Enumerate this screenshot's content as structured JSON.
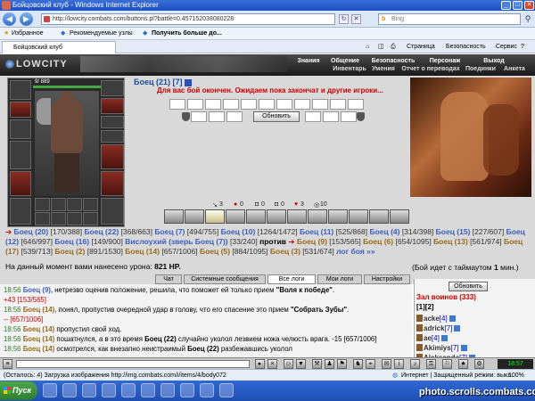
{
  "window": {
    "title": "Бойцовский клуб - Windows Internet Explorer"
  },
  "browser": {
    "url": "http://lowcity.combats.com/buttons.pl?battle=0.457152038080228",
    "search_placeholder": "Bing",
    "favorites_label": "Избранное",
    "fav_items": [
      "Рекомендуемые узлы",
      "Получить больше до..."
    ],
    "tab_title": "Бойцовский клуб",
    "tab_tools": [
      "Страница",
      "Безопасность",
      "Сервис"
    ]
  },
  "site": {
    "logo": "LOWCITY",
    "menu": [
      "Знания",
      "Общение",
      "Безопасность",
      "Персонаж",
      "Выход"
    ],
    "submenu": [
      "Инвентарь",
      "Умения",
      "Отчет о переводах",
      "Поединки",
      "Анкета"
    ]
  },
  "battle": {
    "char_hp": "9/ 889",
    "fighter": "Боец (21) [7]",
    "wait_message": "Для вас бой окончен. Ожидаем пока закончат и другие игроки...",
    "refresh_label": "Обновить",
    "stats": [
      "3",
      "0",
      "0",
      "0",
      "3",
      "10"
    ],
    "team_left": [
      {
        "name": "Боец",
        "lvl": "(20)",
        "hp": "[170/388]"
      },
      {
        "name": "Боец",
        "lvl": "(22)",
        "hp": "[368/663]"
      },
      {
        "name": "Боец",
        "lvl": "(7)",
        "hp": "[494/755]"
      },
      {
        "name": "Боец",
        "lvl": "(10)",
        "hp": "[1264/1472]"
      },
      {
        "name": "Боец",
        "lvl": "(11)",
        "hp": "[525/868]"
      },
      {
        "name": "Боец",
        "lvl": "(4)",
        "hp": "[314/398]"
      },
      {
        "name": "Боец",
        "lvl": "(15)",
        "hp": "[227/607]"
      },
      {
        "name": "Боец",
        "lvl": "(12)",
        "hp": "[646/997]"
      },
      {
        "name": "Боец",
        "lvl": "(16)",
        "hp": "[149/900]"
      },
      {
        "name": "Вислоухий (зверь Боец (7))",
        "lvl": "",
        "hp": "[33/240]"
      }
    ],
    "vs": "против",
    "team_right": [
      {
        "name": "Боец",
        "lvl": "(9)",
        "hp": "[153/565]"
      },
      {
        "name": "Боец",
        "lvl": "(6)",
        "hp": "[654/1095]"
      },
      {
        "name": "Боец",
        "lvl": "(13)",
        "hp": "[561/974]"
      },
      {
        "name": "Боец",
        "lvl": "(17)",
        "hp": "[539/713]"
      },
      {
        "name": "Боец",
        "lvl": "(2)",
        "hp": "[891/1530]"
      },
      {
        "name": "Боец",
        "lvl": "(14)",
        "hp": "[657/1006]"
      },
      {
        "name": "Боец",
        "lvl": "(5)",
        "hp": "[884/1095]"
      },
      {
        "name": "Боец",
        "lvl": "(3)",
        "hp": "[531/674]"
      }
    ],
    "more": "лог боя »»",
    "damage_text": "На данный момент вами нанесено урона:",
    "damage_value": "821 HP.",
    "timeout_text": "(Бой идет с таймаутом",
    "timeout_value": "1",
    "timeout_unit": "мин.)"
  },
  "chat": {
    "tabs": [
      "Чат",
      "Системные сообщения",
      "Все логи",
      "Мои логи",
      "Настройки"
    ],
    "lines": [
      {
        "time": "18:56",
        "text1": "Боец (9),",
        "text2": " нетрезво оценив положение, решила, что поможет ей только прием ",
        "bold": "\"Воля к победе\"",
        "tail": "."
      },
      {
        "time": "",
        "text1": "",
        "text2": "+43 [153/565]",
        "bold": "",
        "tail": ""
      },
      {
        "time": "18:56",
        "text1": "Боец (14),",
        "text2": " понял, пропустив очередной удар в голову, что его спасение это прием ",
        "bold": "\"Собрать Зубы\"",
        "tail": "."
      },
      {
        "time": "",
        "text1": "",
        "text2": "-- [657/1006]",
        "bold": "",
        "tail": ""
      },
      {
        "time": "18:56",
        "text1": "Боец (14)",
        "text2": " пропустил свой ход.",
        "bold": "",
        "tail": ""
      },
      {
        "time": "18:56",
        "text1": "Боец (14)",
        "text2": " пошатнулся, а в это время ",
        "bold": "Боец (22)",
        "tail": " случайно уколол лезвием ножа челюсть врага. -15 [657/1006]"
      },
      {
        "time": "18:56",
        "text1": "Боец (14)",
        "text2": " осмотрелся, как внезапно неистраимый ",
        "bold": "Боец (22)",
        "tail": " разбежавшись уколол"
      }
    ]
  },
  "sidebar": {
    "refresh_label": "Обновить",
    "title": "Зал воинов (333)",
    "pages": "[1][2]",
    "players": [
      {
        "name": "acke",
        "lvl": "[4]"
      },
      {
        "name": "adrick",
        "lvl": "[7]"
      },
      {
        "name": "ae",
        "lvl": "[4]"
      },
      {
        "name": "Akimiys",
        "lvl": "[7]"
      },
      {
        "name": "Aleksanda",
        "lvl": "[7]"
      }
    ]
  },
  "toolbar": {
    "clock": "18:57"
  },
  "status": {
    "left": "(Осталось: 4) Загрузка изображения http://img.combats.com/i/items/4/body072",
    "zone": "Интернет | Защищенный режим: выкл.",
    "zoom": "100%"
  },
  "taskbar": {
    "start": "Пуск"
  },
  "watermark": "photo.scrolls.combats.com"
}
